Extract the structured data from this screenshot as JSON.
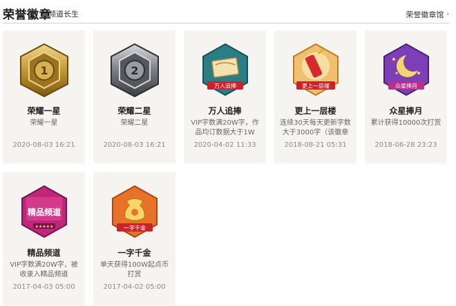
{
  "header": {
    "title": "荣誉徽章",
    "subtitle": "频道长生",
    "hall_link": "荣誉徽章馆"
  },
  "badges": [
    {
      "name": "荣耀一星",
      "desc": "荣耀一星",
      "date": "2020-08-03 16:21",
      "icon": "gold-star-1-medal-icon",
      "badge_text": "1"
    },
    {
      "name": "荣耀二星",
      "desc": "荣耀二星",
      "date": "2020-08-03 16:21",
      "icon": "silver-star-2-medal-icon",
      "badge_text": "2"
    },
    {
      "name": "万人追捧",
      "desc": "VIP字数满20W字，作品均订数据大于1W",
      "date": "2020-04-02 11:33",
      "icon": "scroll-banner-badge-icon",
      "badge_text": "万人追捧"
    },
    {
      "name": "更上一层楼",
      "desc": "连续30天每天更新字数大于3000字（该徽章",
      "date": "2018-08-21 05:31",
      "icon": "firecracker-badge-icon",
      "badge_text": "更上一层楼"
    },
    {
      "name": "众星捧月",
      "desc": "累计获得10000次打赏",
      "date": "2018-06-28 23:23",
      "icon": "moon-stars-badge-icon",
      "badge_text": "众星捧月"
    },
    {
      "name": "精品频道",
      "desc": "VIP字数满20W字，被收录入精品频道",
      "date": "2017-04-03 05:00",
      "icon": "premium-channel-badge-icon",
      "badge_text": "精品频道"
    },
    {
      "name": "一字千金",
      "desc": "单天获得100W起点币打赏",
      "date": "2017-04-02 05:00",
      "icon": "money-bag-badge-icon",
      "badge_text": "一字千金"
    }
  ],
  "colors": {
    "gold": "#b98d2e",
    "silver": "#6e6f74",
    "teal": "#2a7f87",
    "red_banner": "#c7252b",
    "orange": "#e8722a",
    "purple": "#7d3fb8",
    "magenta": "#c0267a"
  }
}
